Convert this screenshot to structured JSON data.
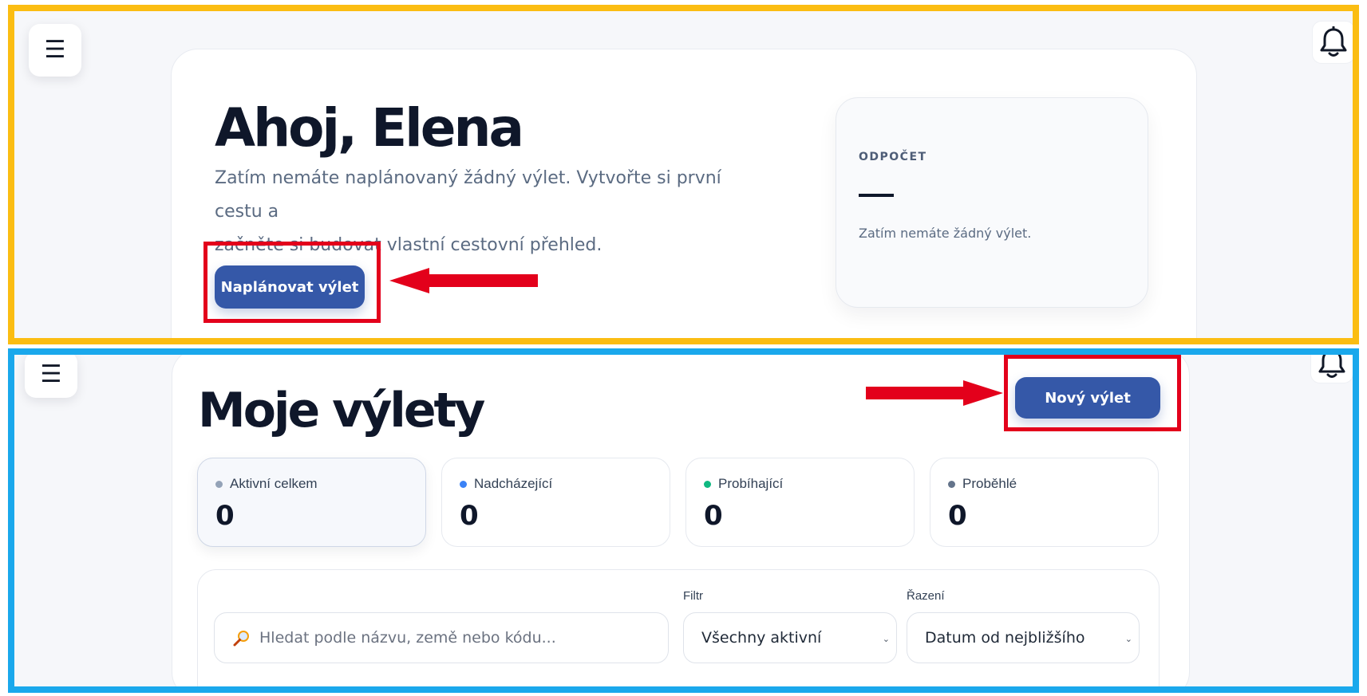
{
  "dashboard": {
    "greeting": "Ahoj, Elena",
    "intro_line1": "Zatím nemáte naplánovaný žádný výlet. Vytvořte si první cestu a",
    "intro_line2": "začněte si budovat vlastní cestovní přehled.",
    "plan_button": "Naplánovat výlet",
    "countdown": {
      "label": "ODPOČET",
      "empty_text": "Zatím nemáte žádný výlet."
    }
  },
  "trips": {
    "title": "Moje výlety",
    "new_button": "Nový výlet",
    "stats": [
      {
        "label": "Aktivní celkem",
        "value": "0",
        "dot_color": "#94a3b8"
      },
      {
        "label": "Nadcházející",
        "value": "0",
        "dot_color": "#3b82f6"
      },
      {
        "label": "Probíhající",
        "value": "0",
        "dot_color": "#10b981"
      },
      {
        "label": "Proběhlé",
        "value": "0",
        "dot_color": "#64748b"
      }
    ],
    "search": {
      "icon": "magnifier-icon",
      "placeholder": "Hledat podle názvu, země nebo kódu..."
    },
    "filter": {
      "label": "Filtr",
      "selected": "Všechny aktivní"
    },
    "sort": {
      "label": "Řazení",
      "selected": "Datum od nejbližšího"
    }
  },
  "colors": {
    "primary": "#3558a8",
    "highlight_red": "#e3001b",
    "frame_top": "#fbbd12",
    "frame_bottom": "#1aa8ec"
  }
}
